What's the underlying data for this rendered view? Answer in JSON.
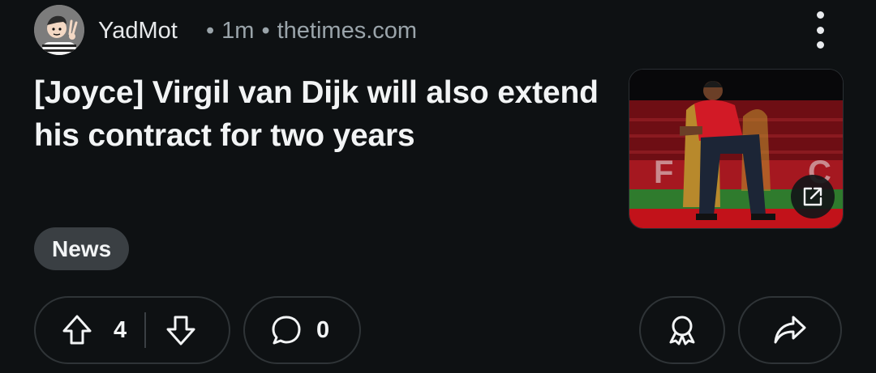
{
  "post": {
    "author": "YadMot",
    "time": "1m",
    "domain": "thetimes.com",
    "title": "[Joyce] Virgil van Dijk will also extend his contract for two years",
    "flair": "News",
    "thumbnail_icon": "external-link-icon"
  },
  "actions": {
    "upvotes": "4",
    "comments": "0",
    "icons": [
      "upvote-icon",
      "downvote-icon",
      "comment-icon",
      "award-icon",
      "share-icon",
      "more-icon"
    ]
  }
}
